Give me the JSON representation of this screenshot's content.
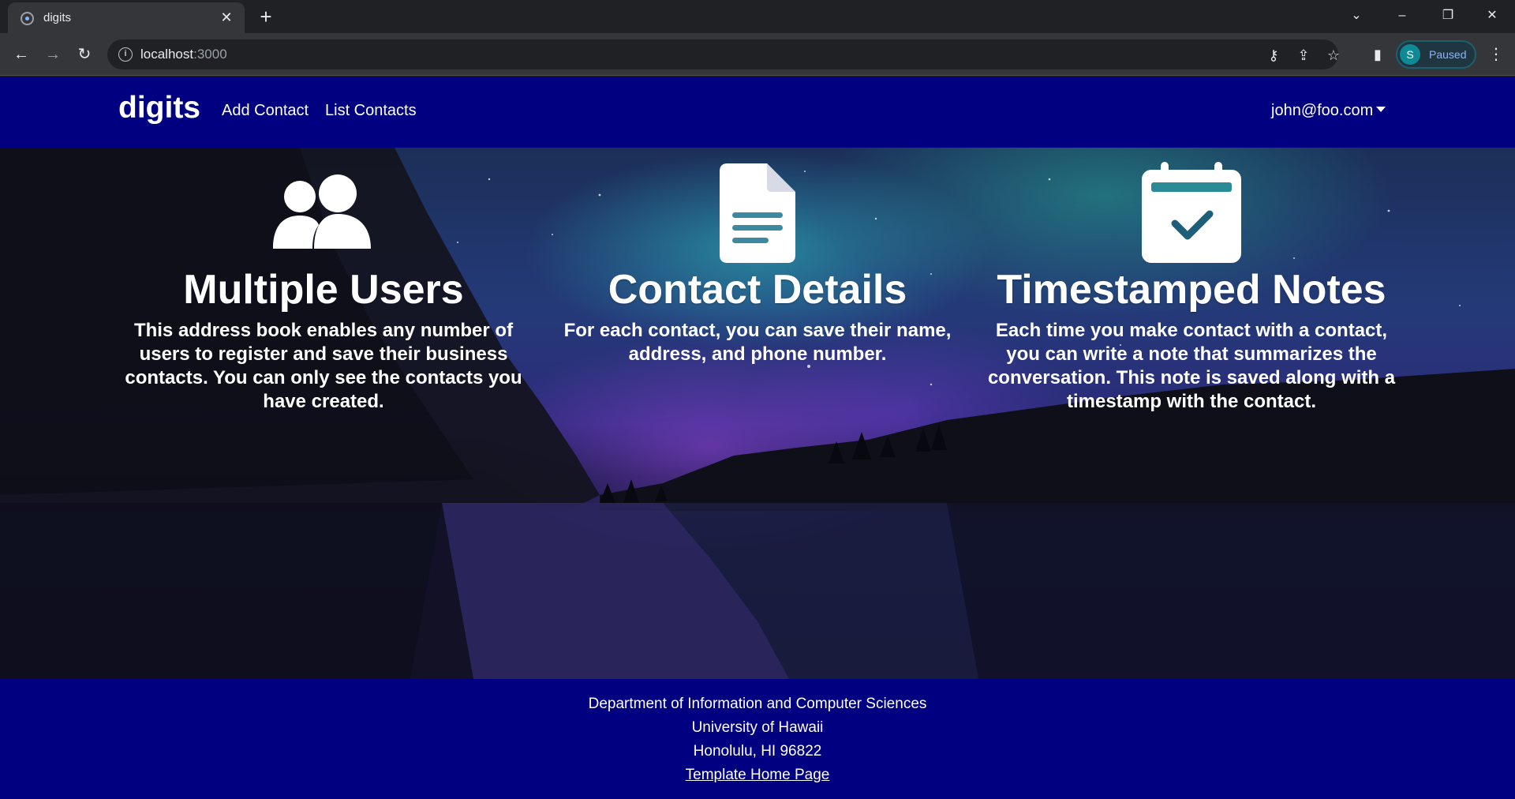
{
  "browser": {
    "tab_title": "digits",
    "url_host": "localhost",
    "url_port": ":3000",
    "profile_initial": "S",
    "profile_status": "Paused"
  },
  "navbar": {
    "brand": "digits",
    "links": [
      "Add Contact",
      "List Contacts"
    ],
    "user": "john@foo.com"
  },
  "features": [
    {
      "icon": "users-icon",
      "title": "Multiple Users",
      "text": "This address book enables any number of users to register and save their business contacts. You can only see the contacts you have created."
    },
    {
      "icon": "file-icon",
      "title": "Contact Details",
      "text": "For each contact, you can save their name, address, and phone number."
    },
    {
      "icon": "calendar-check-icon",
      "title": "Timestamped Notes",
      "text": "Each time you make contact with a contact, you can write a note that summarizes the conversation. This note is saved along with a timestamp with the contact."
    }
  ],
  "footer": {
    "line1": "Department of Information and Computer Sciences",
    "line2": "University of Hawaii",
    "line3": "Honolulu, HI 96822",
    "link": "Template Home Page"
  },
  "colors": {
    "navbar_bg": "#000080",
    "footer_bg": "#000080",
    "icon_fill": "#ffffff"
  }
}
